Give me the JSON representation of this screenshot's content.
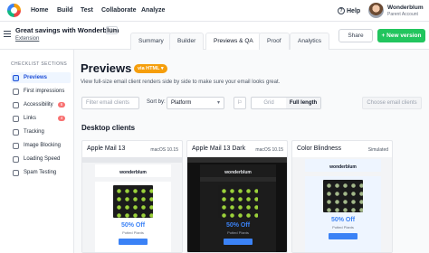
{
  "nav": {
    "items": [
      "Home",
      "Build",
      "Test",
      "Collaborate",
      "Analyze"
    ],
    "help_label": "Help",
    "help_icon": "?",
    "user_name": "Wonderblum",
    "user_role": "Parent Account"
  },
  "header": {
    "campaign_title": "Great savings with Wonderblum",
    "campaign_subtitle": "Extension",
    "more_label": "···",
    "tabs": [
      "Summary",
      "Builder",
      "Previews & QA",
      "Proof",
      "Analytics"
    ],
    "active_tab": "Previews & QA",
    "share_label": "Share",
    "new_version_label": "+ New version"
  },
  "sidebar": {
    "heading": "CHECKLIST SECTIONS",
    "items": [
      {
        "label": "Previews",
        "icon": "previews-icon",
        "active": true
      },
      {
        "label": "First impressions",
        "icon": "eye-icon"
      },
      {
        "label": "Accessibility",
        "icon": "accessibility-icon",
        "badge": "6"
      },
      {
        "label": "Links",
        "icon": "link-icon",
        "badge": "4"
      },
      {
        "label": "Tracking",
        "icon": "tracking-icon"
      },
      {
        "label": "Image Blocking",
        "icon": "image-icon"
      },
      {
        "label": "Loading Speed",
        "icon": "speed-icon"
      },
      {
        "label": "Spam Testing",
        "icon": "spam-icon"
      }
    ]
  },
  "main": {
    "title": "Previews",
    "via_badge": "via HTML ▾",
    "description": "View full-size email client renders side by side to make sure your email looks great.",
    "filter_placeholder": "Filter email clients",
    "sort_label": "Sort by:",
    "sort_value": "Platform",
    "flag_icon": "⚐",
    "view_options": [
      "Grid",
      "Full length"
    ],
    "active_view": "Full length",
    "choose_label": "Choose email clients",
    "section_title": "Desktop clients"
  },
  "cards": [
    {
      "title": "Apple Mail 13",
      "meta": "macOS 10.15"
    },
    {
      "title": "Apple Mail 13 Dark",
      "meta": "macOS 10.15"
    },
    {
      "title": "Color Blindness",
      "meta": "Simulated"
    }
  ],
  "email": {
    "brand": "wonderblum",
    "offer": "50% Off",
    "offer_sub": "Potted Plants"
  },
  "colors": {
    "accent_green": "#22c55e",
    "via_orange": "#f59e0b",
    "badge_red": "#f87171",
    "offer_blue": "#3b82f6"
  }
}
